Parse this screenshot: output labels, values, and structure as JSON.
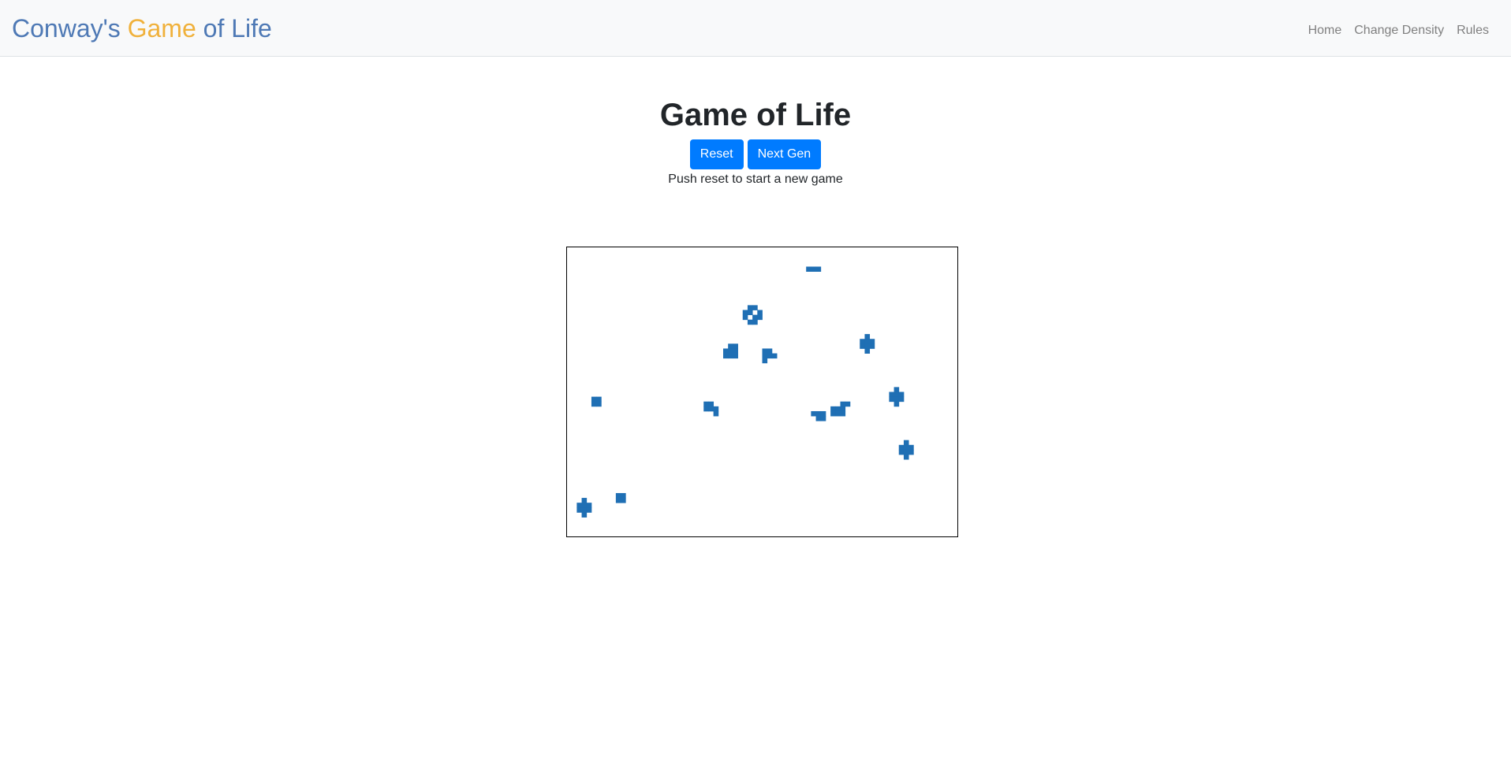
{
  "navbar": {
    "brand_parts": [
      "Conway's ",
      "Game",
      " of Life"
    ],
    "links": [
      "Home",
      "Change Density",
      "Rules"
    ],
    "colors": {
      "brand_primary": "#4e79b5",
      "brand_accent": "#f0b13b"
    }
  },
  "main": {
    "title": "Game of Life",
    "reset_label": "Reset",
    "next_gen_label": "Next Gen",
    "hint": "Push reset to start a new game"
  },
  "board": {
    "cell_color": "#1f6fb4",
    "cols": 80,
    "rows": 60,
    "live_cells": [
      [
        49,
        4
      ],
      [
        50,
        4
      ],
      [
        51,
        4
      ],
      [
        37,
        12
      ],
      [
        38,
        12
      ],
      [
        36,
        13
      ],
      [
        37,
        13
      ],
      [
        39,
        13
      ],
      [
        36,
        14
      ],
      [
        38,
        14
      ],
      [
        39,
        14
      ],
      [
        37,
        15
      ],
      [
        38,
        15
      ],
      [
        33,
        20
      ],
      [
        34,
        20
      ],
      [
        32,
        21
      ],
      [
        33,
        21
      ],
      [
        34,
        21
      ],
      [
        32,
        22
      ],
      [
        33,
        22
      ],
      [
        34,
        22
      ],
      [
        40,
        21
      ],
      [
        41,
        21
      ],
      [
        40,
        22
      ],
      [
        41,
        22
      ],
      [
        42,
        22
      ],
      [
        40,
        23
      ],
      [
        61,
        18
      ],
      [
        60,
        19
      ],
      [
        61,
        19
      ],
      [
        62,
        19
      ],
      [
        60,
        20
      ],
      [
        61,
        20
      ],
      [
        62,
        20
      ],
      [
        61,
        21
      ],
      [
        5,
        31
      ],
      [
        6,
        31
      ],
      [
        5,
        32
      ],
      [
        6,
        32
      ],
      [
        28,
        32
      ],
      [
        29,
        32
      ],
      [
        28,
        33
      ],
      [
        29,
        33
      ],
      [
        30,
        33
      ],
      [
        30,
        34
      ],
      [
        50,
        34
      ],
      [
        51,
        34
      ],
      [
        52,
        34
      ],
      [
        51,
        35
      ],
      [
        52,
        35
      ],
      [
        54,
        33
      ],
      [
        55,
        33
      ],
      [
        56,
        33
      ],
      [
        54,
        34
      ],
      [
        55,
        34
      ],
      [
        56,
        34
      ],
      [
        56,
        32
      ],
      [
        57,
        32
      ],
      [
        67,
        29
      ],
      [
        66,
        30
      ],
      [
        67,
        30
      ],
      [
        68,
        30
      ],
      [
        66,
        31
      ],
      [
        67,
        31
      ],
      [
        68,
        31
      ],
      [
        67,
        32
      ],
      [
        69,
        40
      ],
      [
        68,
        41
      ],
      [
        69,
        41
      ],
      [
        70,
        41
      ],
      [
        68,
        42
      ],
      [
        69,
        42
      ],
      [
        70,
        42
      ],
      [
        69,
        43
      ],
      [
        10,
        51
      ],
      [
        11,
        51
      ],
      [
        10,
        52
      ],
      [
        11,
        52
      ],
      [
        3,
        52
      ],
      [
        2,
        53
      ],
      [
        3,
        53
      ],
      [
        4,
        53
      ],
      [
        2,
        54
      ],
      [
        3,
        54
      ],
      [
        4,
        54
      ],
      [
        3,
        55
      ]
    ]
  }
}
